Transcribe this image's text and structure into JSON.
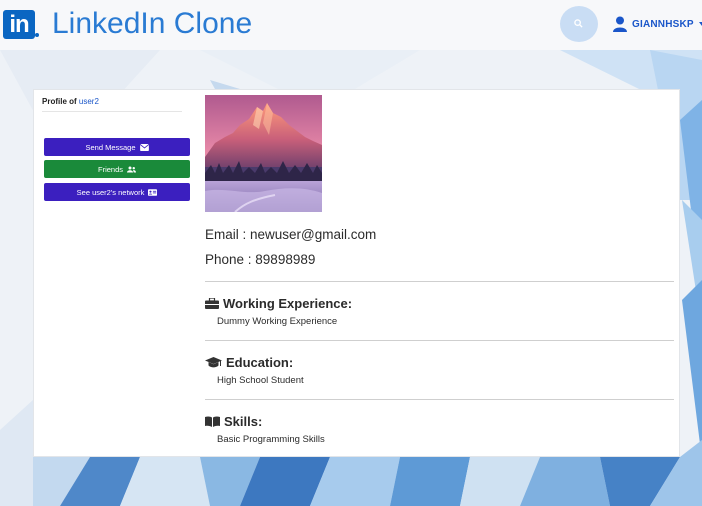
{
  "navbar": {
    "logo_text": "in",
    "brand": "LinkedIn Clone",
    "user_name": "GIANNHSKP",
    "accent_color": "#0a66c2"
  },
  "sidebar": {
    "profile_label": "Profile of",
    "profile_user": "user2",
    "buttons": [
      {
        "label": "Send Message",
        "icon": "envelope-icon",
        "color": "#3b1fbf"
      },
      {
        "label": "Friends",
        "icon": "users-icon",
        "color": "#1a8a3a"
      },
      {
        "label": "See user2's network",
        "icon": "id-card-icon",
        "color": "#3b1fbf"
      }
    ]
  },
  "profile": {
    "email_line": "Email : newuser@gmail.com",
    "phone_line": "Phone : 89898989",
    "sections": [
      {
        "title": "Working Experience:",
        "icon": "briefcase-icon",
        "text": "Dummy Working Experience"
      },
      {
        "title": "Education:",
        "icon": "graduation-cap-icon",
        "text": "High School Student"
      },
      {
        "title": "Skills:",
        "icon": "book-icon",
        "text": "Basic Programming Skills"
      }
    ]
  }
}
